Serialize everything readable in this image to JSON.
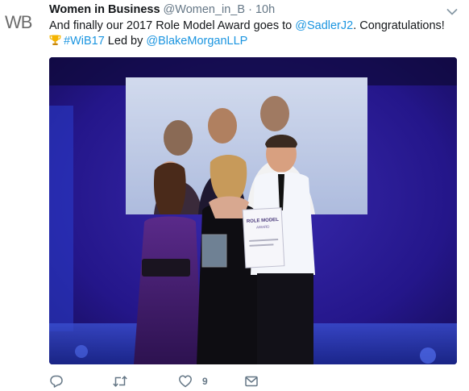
{
  "author": {
    "avatar_text": "WB",
    "display_name": "Women in Business",
    "handle": "@Women_in_B",
    "separator": "·",
    "time": "10h"
  },
  "tweet": {
    "line1_prefix": "And finally our 2017 Role Model Award goes to ",
    "mention1": "@SadlerJ2",
    "line1_suffix": ". Congratulations!",
    "hashtag": "#WiB17",
    "line2_middle": " Led by ",
    "mention2": "@BlakeMorganLLP"
  },
  "photo": {
    "certificate_line1": "ROLE MODEL",
    "certificate_line2": "AWARD"
  },
  "actions": {
    "like_count": "9"
  },
  "icons": {
    "caret": "chevron-down-icon",
    "trophy": "trophy-icon",
    "reply": "reply-icon",
    "retweet": "retweet-icon",
    "like": "heart-icon",
    "message": "envelope-icon"
  },
  "colors": {
    "link": "#1b95e0",
    "muted": "#657786",
    "text": "#14171a",
    "stage_blue": "#2b1a8a"
  }
}
